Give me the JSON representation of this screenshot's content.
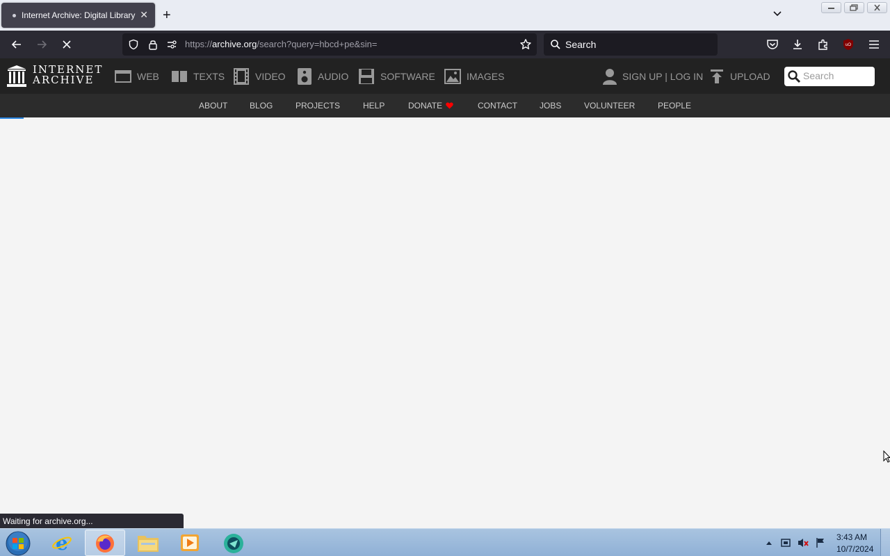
{
  "browser": {
    "tab_title": "Internet Archive: Digital Library",
    "url_prefix": "https://",
    "url_host": "archive.org",
    "url_path": "/search?query=hbcd+pe&sin=",
    "search_label": "Search",
    "status_text": "Waiting for archive.org..."
  },
  "site": {
    "logo_line1": "INTERNET",
    "logo_line2": "ARCHIVE",
    "media_nav": [
      {
        "label": "WEB",
        "icon": "web-icon"
      },
      {
        "label": "TEXTS",
        "icon": "book-icon"
      },
      {
        "label": "VIDEO",
        "icon": "film-icon"
      },
      {
        "label": "AUDIO",
        "icon": "speaker-icon"
      },
      {
        "label": "SOFTWARE",
        "icon": "floppy-icon"
      },
      {
        "label": "IMAGES",
        "icon": "image-icon"
      }
    ],
    "signup_label": "SIGN UP | LOG IN",
    "upload_label": "UPLOAD",
    "search_placeholder": "Search",
    "sub_nav": [
      "ABOUT",
      "BLOG",
      "PROJECTS",
      "HELP",
      "DONATE",
      "CONTACT",
      "JOBS",
      "VOLUNTEER",
      "PEOPLE"
    ]
  },
  "taskbar": {
    "time": "3:43 AM",
    "date": "10/7/2024"
  },
  "colors": {
    "donate_heart": "#ff0000",
    "load_progress": "#2b87e3"
  }
}
